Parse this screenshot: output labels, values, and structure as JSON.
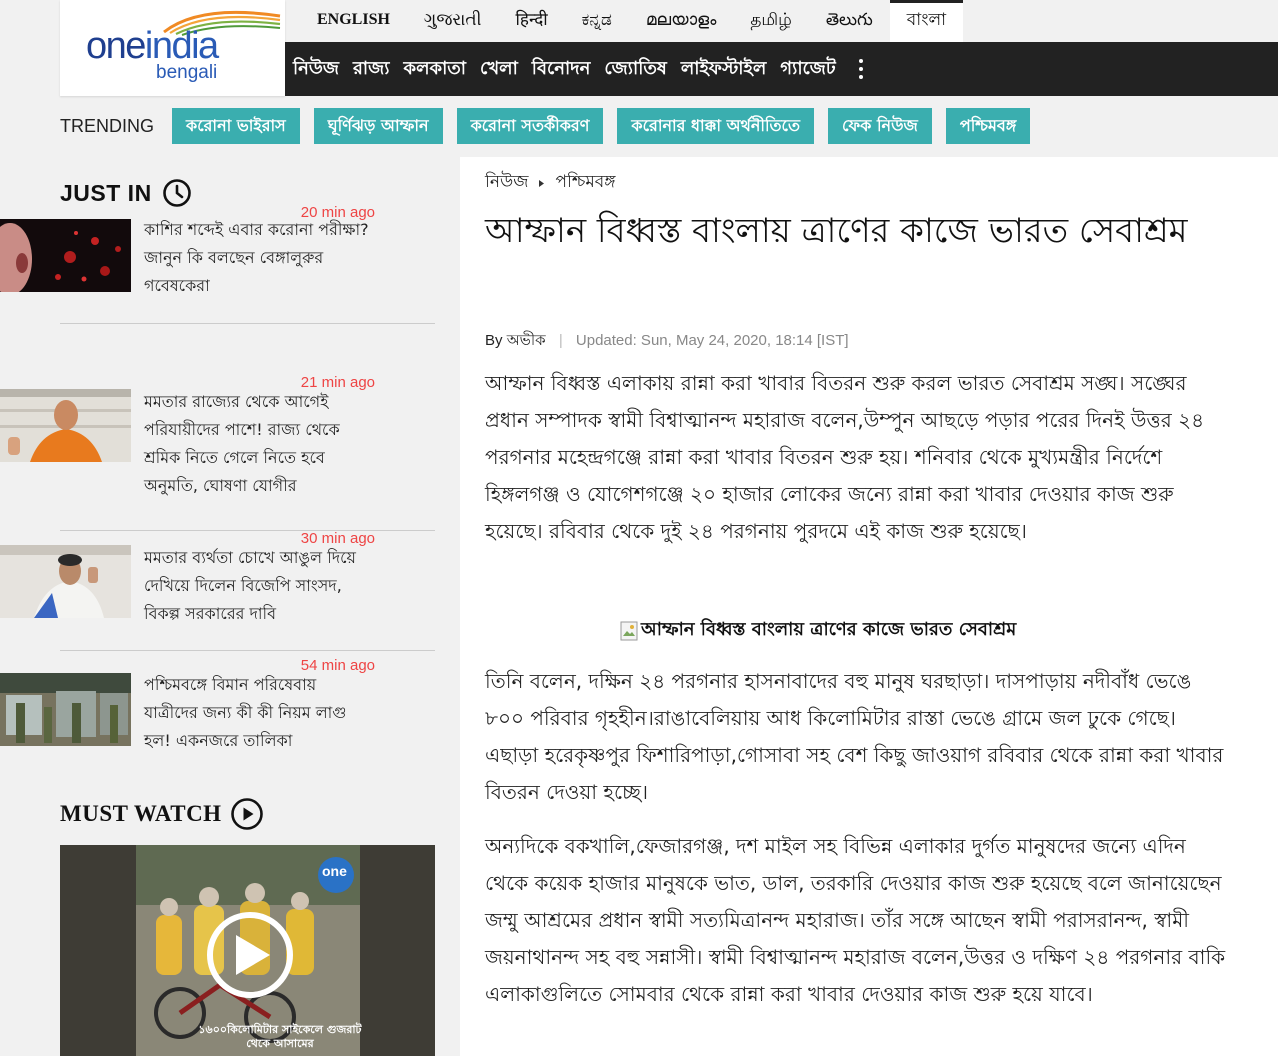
{
  "logo": {
    "brand_part1": "one",
    "brand_part2": "india",
    "sub": "bengali"
  },
  "languages": [
    {
      "label": "ENGLISH"
    },
    {
      "label": "ગુજરાતી"
    },
    {
      "label": "हिन्दी"
    },
    {
      "label": "ಕನ್ನಡ"
    },
    {
      "label": "മലയാളം"
    },
    {
      "label": "தமிழ்"
    },
    {
      "label": "తెలుగు"
    },
    {
      "label": "বাংলা",
      "active": true
    }
  ],
  "nav": [
    "নিউজ",
    "রাজ্য",
    "কলকাতা",
    "খেলা",
    "বিনোদন",
    "জ্যোতিষ",
    "লাইফস্টাইল",
    "গ্যাজেট"
  ],
  "trending": {
    "label": "TRENDING",
    "tags": [
      "করোনা ভাইরাস",
      "ঘূর্ণিঝড় আম্ফান",
      "করোনা সতর্কীকরণ",
      "করোনার ধাক্কা অর্থনীতিতে",
      "ফেক নিউজ",
      "পশ্চিমবঙ্গ"
    ]
  },
  "just_in": {
    "title": "JUST IN",
    "items": [
      {
        "time": "20 min ago",
        "text": "কাশির শব্দেই এবার করোনা পরীক্ষা? জানুন কি বলছেন বেঙ্গালুরুর গবেষকেরা"
      },
      {
        "time": "21 min ago",
        "text": "মমতার রাজ্যের থেকে আগেই পরিযায়ীদের পাশে! রাজ্য থেকে শ্রমিক নিতে গেলে নিতে হবে অনুমতি, ঘোষণা যোগীর"
      },
      {
        "time": "30 min ago",
        "text": "মমতার ব্যর্থতা চোখে আঙুল দিয়ে দেখিয়ে দিলেন বিজেপি সাংসদ, বিকল্প সরকারের দাবি"
      },
      {
        "time": "54 min ago",
        "text": "পশ্চিমবঙ্গে বিমান পরিষেবায় যাত্রীদের জন্য কী কী নিয়ম লাগু হল! একনজরে তালিকা"
      }
    ]
  },
  "must_watch": {
    "title": "MUST WATCH",
    "video_overlay_text": "১৬০০কিলোমিটার সাইকেলে গুজরাট থেকে আসামের"
  },
  "article": {
    "breadcrumb": [
      "নিউজ",
      "পশ্চিমবঙ্গ"
    ],
    "title": "আম্ফান বিধ্বস্ত বাংলায় ত্রাণের কাজে ভারত সেবাশ্রম",
    "by_label": "By",
    "author": "অভীক",
    "updated": "Updated: Sun, May 24, 2020, 18:14 [IST]",
    "paragraphs": [
      "আম্ফান বিধ্বস্ত এলাকায় রান্না করা খাবার বিতরন শুরু করল ভারত সেবাশ্রম সঙ্ঘ। সঙ্ঘের প্রধান সম্পাদক স্বামী বিশ্বাত্মানন্দ মহারাজ বলেন,উম্পুন আছড়ে পড়ার পরের দিনই উত্তর ২৪ পরগনার মহেন্দ্রগঞ্জে রান্না করা খাবার বিতরন শুরু হয়। শনিবার থেকে মুখ্যমন্ত্রীর নির্দেশে হিঙ্গলগঞ্জ ও যোগেশগঞ্জে ২০ হাজার লোকের জন্যে রান্না করা খাবার দেওয়ার কাজ শুরু হয়েছে। রবিবার থেকে দুই ২৪ পরগনায় পুরদমে এই কাজ শুরু হয়েছে।",
      "তিনি বলেন, দক্ষিন ২৪ পরগনার হাসনাবাদের বহু মানুষ ঘরছাড়া। দাসপাড়ায় নদীবাঁধ ভেঙে ৮০০ পরিবার গৃহহীন।রাঙাবেলিয়ায় আধ কিলোমিটার রাস্তা ভেঙে গ্রামে জল ঢুকে গেছে। এছাড়া হরেকৃষ্ণপুর ফিশারিপাড়া,গোসাবা সহ বেশ কিছু জাওয়াগ রবিবার থেকে রান্না করা খাবার বিতরন দেওয়া হচ্ছে।",
      "অন্যদিকে বকখালি,ফেজারগঞ্জ, দশ মাইল সহ বিভিন্ন এলাকার দুর্গত মানুষদের জন্যে এদিন থেকে কয়েক হাজার মানুষকে ভাত, ডাল, তরকারি দেওয়ার কাজ শুরু হয়েছে বলে জানায়েছেন জম্মু আশ্রমের প্রধান স্বামী সত্যমিত্রানন্দ মহারাজ। তাঁর সঙ্গে আছেন স্বামী পরাসরানন্দ, স্বামী জয়নাথানন্দ সহ বহু সন্নাসী। স্বামী বিশ্বাত্মানন্দ মহারাজ বলেন,উত্তর ও দক্ষিণ ২৪ পরগনার বাকি এলাকাগুলিতে সোমবার থেকে রান্না করা খাবার দেওয়ার কাজ শুরু হয়ে যাবে।"
    ],
    "image_caption": "আম্ফান বিধ্বস্ত বাংলায় ত্রাণের কাজে ভারত সেবাশ্রম"
  },
  "icons": {
    "clock": "clock-icon",
    "play": "play-circle-icon",
    "more": "vertical-dots-icon",
    "breadcrumb_sep": "triangle-right-icon",
    "broken_image": "broken-image-icon"
  },
  "colors": {
    "nav_bg": "#222222",
    "trend_tag_bg": "#3aaeaf",
    "time_text": "#ee4444",
    "brand_blue": "#2a5bb6"
  }
}
